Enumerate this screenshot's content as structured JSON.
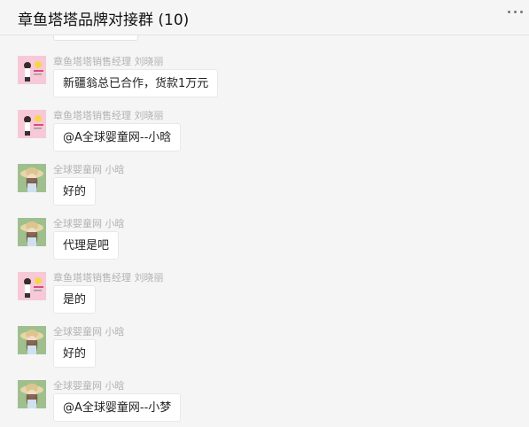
{
  "header": {
    "title": "章鱼塔塔品牌对接群 (10)",
    "more_icon": "more-horizontal-icon"
  },
  "messages": [
    {
      "sender": "章鱼塔塔销售经理  刘晓丽",
      "text": "新疆翁总已合作，货款1万元",
      "avatar": "octopus-brand-avatar"
    },
    {
      "sender": "章鱼塔塔销售经理  刘晓丽",
      "text": "@A全球婴童网--小晗",
      "avatar": "octopus-brand-avatar"
    },
    {
      "sender": "全球婴童网  小晗",
      "text": "好的",
      "avatar": "girl-straw-hat-avatar"
    },
    {
      "sender": "全球婴童网  小晗",
      "text": "代理是吧",
      "avatar": "girl-straw-hat-avatar"
    },
    {
      "sender": "章鱼塔塔销售经理  刘晓丽",
      "text": "是的",
      "avatar": "octopus-brand-avatar"
    },
    {
      "sender": "全球婴童网  小晗",
      "text": "好的",
      "avatar": "girl-straw-hat-avatar"
    },
    {
      "sender": "全球婴童网  小晗",
      "text": "@A全球婴童网--小梦",
      "avatar": "girl-straw-hat-avatar"
    }
  ],
  "colors": {
    "background": "#f5f5f5",
    "bubble": "#ffffff",
    "sender_text": "#b2b2b2",
    "brand_avatar_bg": "#f7c9d8",
    "girl_avatar_bg": "#9fbf8e"
  }
}
